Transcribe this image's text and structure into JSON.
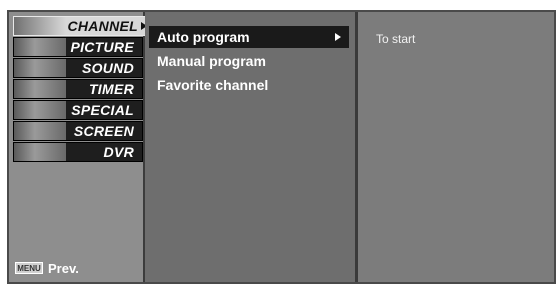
{
  "categories": [
    {
      "label": "CHANNEL",
      "icon": "channel-thumbnail-icon",
      "active": true
    },
    {
      "label": "PICTURE",
      "icon": "picture-thumbnail-icon",
      "active": false
    },
    {
      "label": "SOUND",
      "icon": "sound-thumbnail-icon",
      "active": false
    },
    {
      "label": "TIMER",
      "icon": "timer-thumbnail-icon",
      "active": false
    },
    {
      "label": "SPECIAL",
      "icon": "special-thumbnail-icon",
      "active": false
    },
    {
      "label": "SCREEN",
      "icon": "screen-thumbnail-icon",
      "active": false
    },
    {
      "label": "DVR",
      "icon": "dvr-thumbnail-icon",
      "active": false
    }
  ],
  "submenu": {
    "items": [
      {
        "label": "Auto program",
        "selected": true
      },
      {
        "label": "Manual program",
        "selected": false
      },
      {
        "label": "Favorite channel",
        "selected": false
      }
    ]
  },
  "info": {
    "text": "To start"
  },
  "footer": {
    "menu_key": "MENU",
    "prev_label": "Prev."
  },
  "colors": {
    "selected_bg": "#1a1a1a",
    "panel_bg": "#6e6e6e",
    "text": "#ffffff"
  }
}
